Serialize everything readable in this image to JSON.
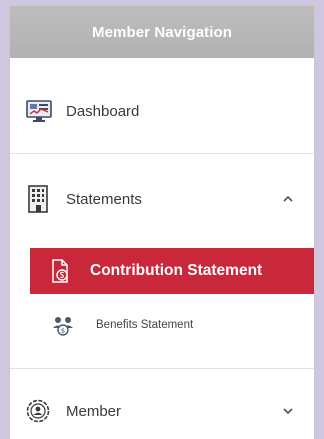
{
  "panel": {
    "title": "Member Navigation"
  },
  "nav": {
    "dashboard": {
      "label": "Dashboard",
      "icon": "dashboard-icon"
    },
    "statements": {
      "label": "Statements",
      "icon": "building-icon",
      "expanded": true
    },
    "contribution": {
      "label": "Contribution Statement",
      "icon": "document-money-icon",
      "active": true
    },
    "benefits": {
      "label": "Benefits Statement",
      "icon": "people-money-icon"
    },
    "member": {
      "label": "Member",
      "icon": "member-settings-icon",
      "expanded": false
    }
  },
  "colors": {
    "accent": "#c8283a",
    "header_bg": "#b8b8b8",
    "page_bg": "#cfc7df"
  }
}
